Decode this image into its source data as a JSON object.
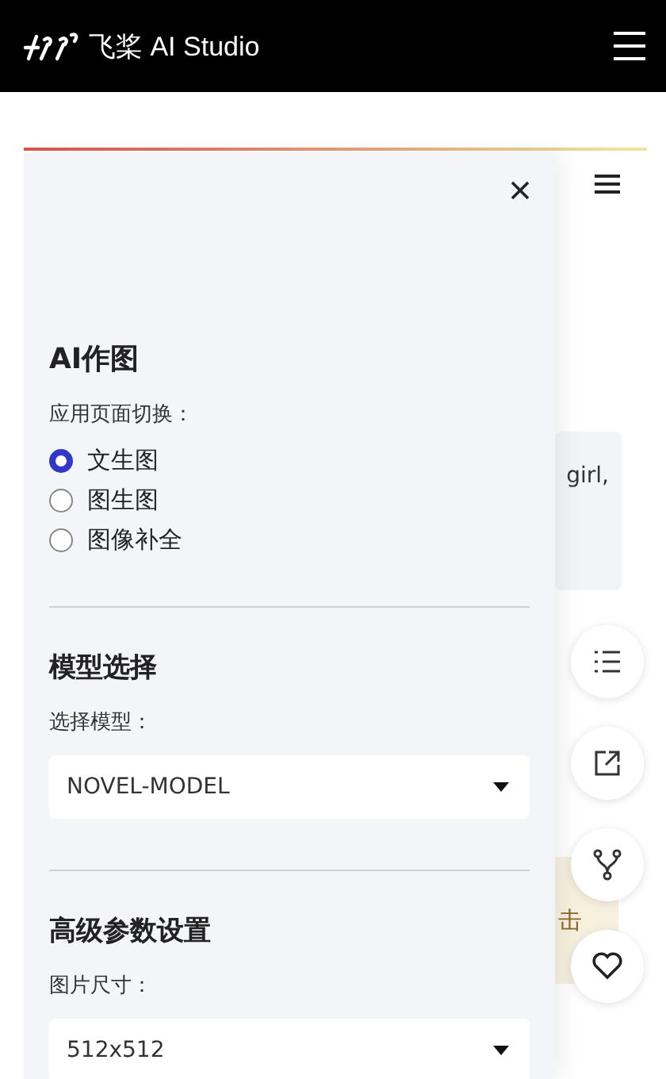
{
  "header": {
    "logo_text": "飞桨 AI Studio"
  },
  "main": {
    "prompt_text": "girl,",
    "notice_text": "击"
  },
  "sidebar": {
    "title": "AI作图",
    "switch_label": "应用页面切换：",
    "options": [
      {
        "label": "文生图",
        "selected": true
      },
      {
        "label": "图生图",
        "selected": false
      },
      {
        "label": "图像补全",
        "selected": false
      }
    ],
    "sections": [
      {
        "title": "模型选择",
        "field_label": "选择模型：",
        "value": "NOVEL-MODEL"
      },
      {
        "title": "高级参数设置",
        "field_label": "图片尺寸：",
        "value": "512x512"
      }
    ]
  }
}
